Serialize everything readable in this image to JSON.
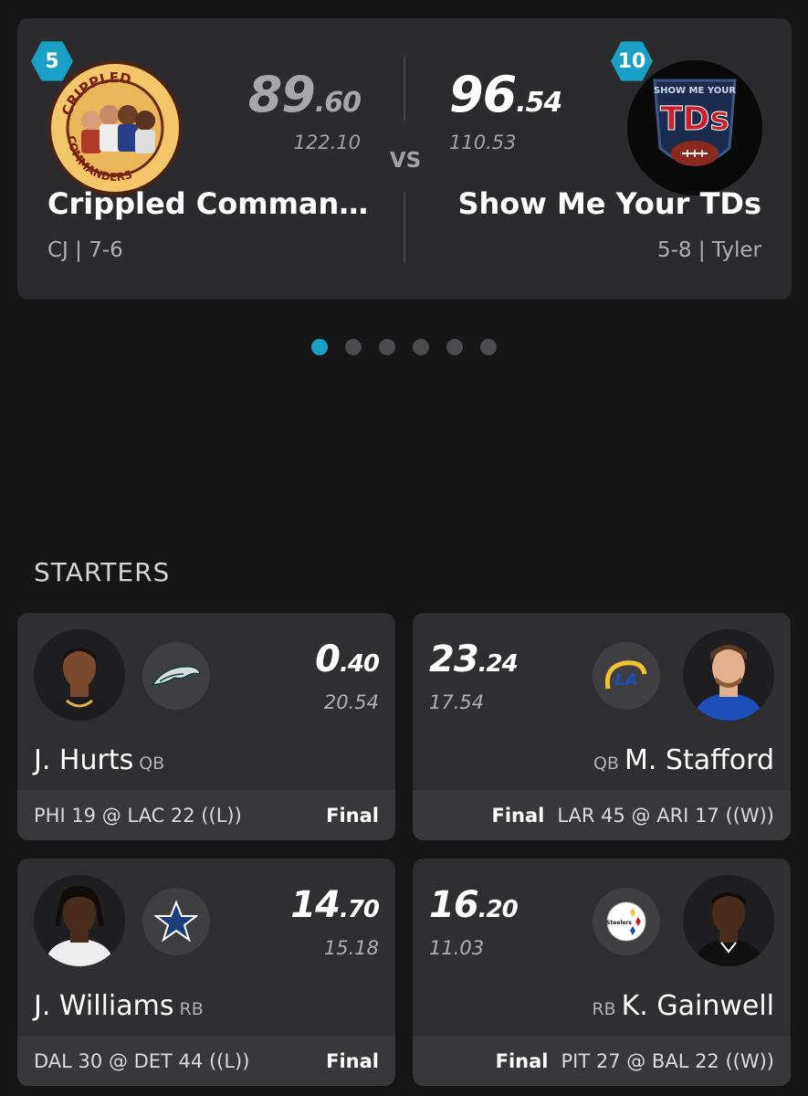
{
  "matchup": {
    "left": {
      "seed": "5",
      "score_int": "89",
      "score_dec": ".60",
      "projected": "122.10",
      "name": "Crippled Comman…",
      "record": "CJ | 7-6",
      "logo_text_top": "CRIPPLED",
      "logo_text_bottom": "COMMANDERS"
    },
    "vs": "VS",
    "right": {
      "seed": "10",
      "score_int": "96",
      "score_dec": ".54",
      "projected": "110.53",
      "name": "Show Me Your TDs",
      "record": "5-8 | Tyler",
      "logo_text_top": "SHOW ME YOUR",
      "logo_text_main": "TDs"
    }
  },
  "pager": {
    "count": 6,
    "active": 0
  },
  "section_title": "STARTERS",
  "players": [
    {
      "score_int": "0",
      "score_dec": ".40",
      "projected": "20.54",
      "name": "J. Hurts",
      "position": "QB",
      "game": "PHI 19 @ LAC 22 ((L))",
      "status": "Final",
      "team_icon": "eagles-icon"
    },
    {
      "score_int": "23",
      "score_dec": ".24",
      "projected": "17.54",
      "name": "M. Stafford",
      "position": "QB",
      "game": "LAR 45 @ ARI 17 ((W))",
      "status": "Final",
      "team_icon": "rams-icon"
    },
    {
      "score_int": "14",
      "score_dec": ".70",
      "projected": "15.18",
      "name": "J. Williams",
      "position": "RB",
      "game": "DAL 30 @ DET 44 ((L))",
      "status": "Final",
      "team_icon": "cowboys-icon"
    },
    {
      "score_int": "16",
      "score_dec": ".20",
      "projected": "11.03",
      "name": "K. Gainwell",
      "position": "RB",
      "game": "PIT 27 @ BAL 22 ((W))",
      "status": "Final",
      "team_icon": "steelers-icon"
    }
  ],
  "colors": {
    "accent": "#1a9fc6",
    "background": "#161617",
    "card": "#2f2f31"
  }
}
